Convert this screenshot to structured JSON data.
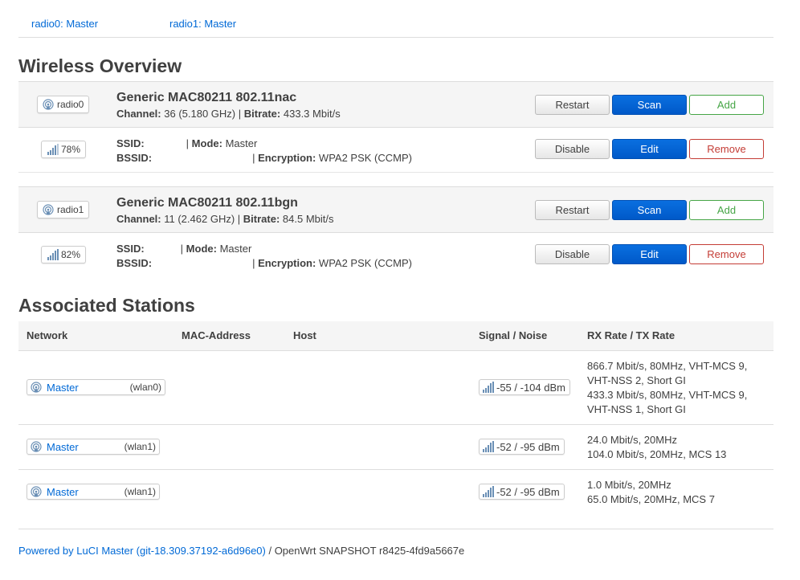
{
  "tabs": [
    "radio0: Master",
    "radio1: Master"
  ],
  "wireless": {
    "heading": "Wireless Overview",
    "labels": {
      "channel": "Channel:",
      "bitrate": "Bitrate:",
      "ssid": "SSID:",
      "mode": "Mode:",
      "bssid": "BSSID:",
      "encryption": "Encryption:"
    },
    "radios": [
      {
        "badge": "radio0",
        "title": "Generic MAC80211 802.11nac",
        "channel": "36 (5.180 GHz)",
        "bitrate": "433.3 Mbit/s",
        "buttons": {
          "restart": "Restart",
          "scan": "Scan",
          "add": "Add"
        },
        "net": {
          "signal": "78%",
          "mode": "Master",
          "encryption": "WPA2 PSK (CCMP)",
          "buttons": {
            "disable": "Disable",
            "edit": "Edit",
            "remove": "Remove"
          }
        }
      },
      {
        "badge": "radio1",
        "title": "Generic MAC80211 802.11bgn",
        "channel": "11 (2.462 GHz)",
        "bitrate": "84.5 Mbit/s",
        "buttons": {
          "restart": "Restart",
          "scan": "Scan",
          "add": "Add"
        },
        "net": {
          "signal": "82%",
          "mode": "Master",
          "encryption": "WPA2 PSK (CCMP)",
          "buttons": {
            "disable": "Disable",
            "edit": "Edit",
            "remove": "Remove"
          }
        }
      }
    ]
  },
  "stations": {
    "heading": "Associated Stations",
    "columns": [
      "Network",
      "MAC-Address",
      "Host",
      "Signal / Noise",
      "RX Rate / TX Rate"
    ],
    "rows": [
      {
        "network": "Master",
        "iface": "(wlan0)",
        "signal": "-55 / -104 dBm",
        "rates": "866.7 Mbit/s, 80MHz, VHT-MCS 9,\nVHT-NSS 2, Short GI\n433.3 Mbit/s, 80MHz, VHT-MCS 9,\nVHT-NSS 1, Short GI"
      },
      {
        "network": "Master",
        "iface": "(wlan1)",
        "signal": "-52 / -95 dBm",
        "rates": "24.0 Mbit/s, 20MHz\n104.0 Mbit/s, 20MHz, MCS 13"
      },
      {
        "network": "Master",
        "iface": "(wlan1)",
        "signal": "-52 / -95 dBm",
        "rates": "1.0 Mbit/s, 20MHz\n65.0 Mbit/s, 20MHz, MCS 7"
      }
    ]
  },
  "footer": {
    "link": "Powered by LuCI Master (git-18.309.37192-a6d96e0)",
    "text": " / OpenWrt SNAPSHOT r8425-4fd9a5667e"
  },
  "colors": {
    "link": "#0069d6",
    "primary": "#0061d6",
    "positive": "#46a546",
    "negative": "#c43c35"
  }
}
